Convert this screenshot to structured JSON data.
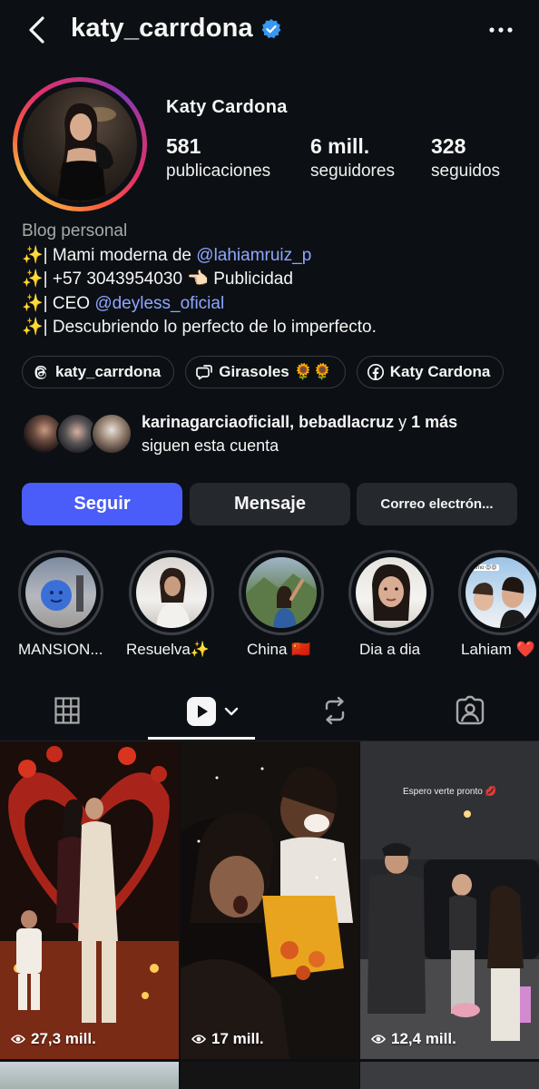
{
  "header": {
    "username": "katy_carrdona",
    "verified": true
  },
  "profile": {
    "name": "Katy  Cardona",
    "stats": [
      {
        "value": "581",
        "label": "publicaciones"
      },
      {
        "value": "6 mill.",
        "label": "seguidores"
      },
      {
        "value": "328",
        "label": "seguidos"
      }
    ]
  },
  "bio": {
    "category": "Blog personal",
    "line1_prefix": "✨| Mami moderna de ",
    "line1_mention": "@lahiamruiz_p",
    "line2": "✨| +57 3043954030 👈🏻 Publicidad",
    "line3_prefix": "✨| CEO ",
    "line3_mention": "@deyless_oficial",
    "line4": "✨| Descubriendo lo perfecto de lo imperfecto."
  },
  "chips": [
    {
      "icon": "threads-icon",
      "label": "katy_carrdona"
    },
    {
      "icon": "channel-icon",
      "label": "Girasoles 🌻🌻"
    },
    {
      "icon": "facebook-icon",
      "label": "Katy Cardona"
    }
  ],
  "followed_by": {
    "names": "karinagarciaoficiall, bebadlacruz",
    "connector": " y ",
    "more": "1 más",
    "suffix": "siguen esta cuenta"
  },
  "actions": {
    "follow": "Seguir",
    "message": "Mensaje",
    "email": "Correo electrón..."
  },
  "highlights": [
    {
      "label": "MANSION..."
    },
    {
      "label": "Resuelva✨"
    },
    {
      "label": "China 🇨🇳"
    },
    {
      "label": "Dia a dia"
    },
    {
      "label": "Lahiam ❤️"
    }
  ],
  "highlight_overlay_text": "Amo 😍😍",
  "tabs": [
    {
      "icon": "grid-icon"
    },
    {
      "icon": "reels-icon",
      "active": true
    },
    {
      "icon": "reposts-icon"
    },
    {
      "icon": "tagged-icon"
    }
  ],
  "grid": [
    {
      "views": "27,3 mill."
    },
    {
      "views": "17 mill."
    },
    {
      "views": "12,4 mill.",
      "caption": "Espero verte pronto 💋"
    }
  ],
  "colors": {
    "background": "#0c1014",
    "follow_button": "#4a5df9",
    "mention": "#8ea6ff",
    "verified": "#3897f0"
  }
}
